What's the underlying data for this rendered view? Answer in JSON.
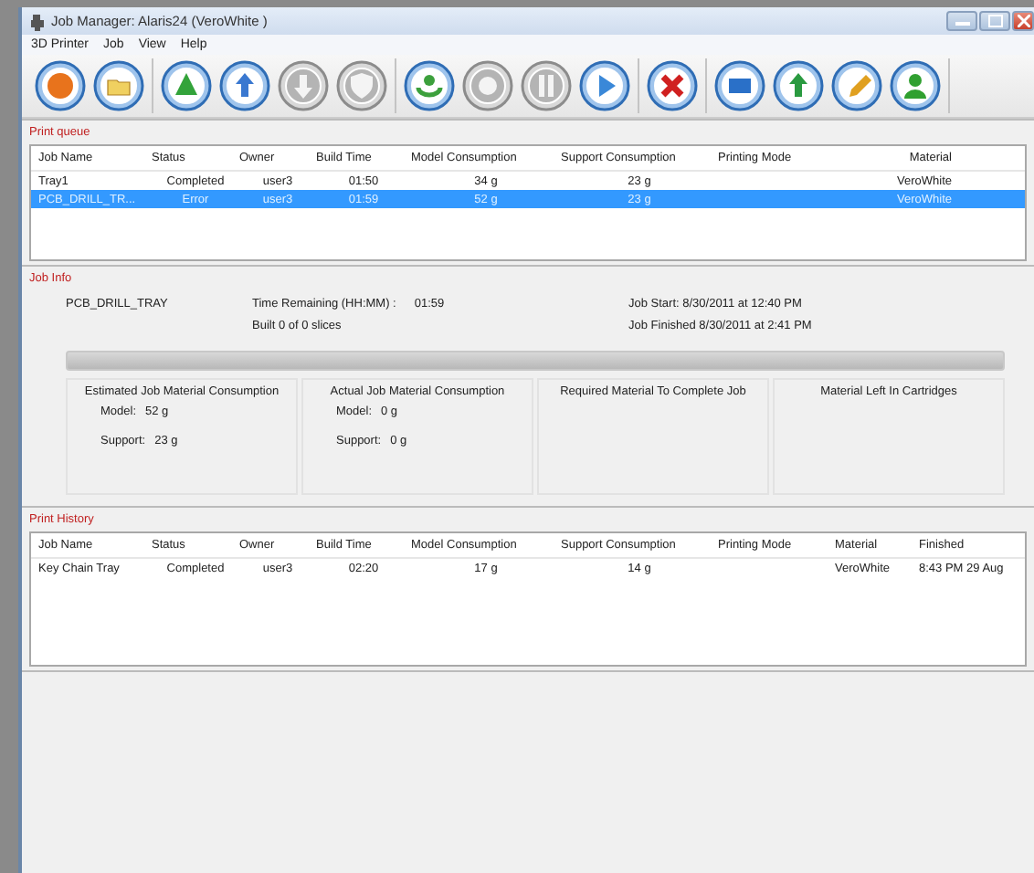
{
  "window": {
    "title": "Job Manager: Alaris24 (VeroWhite )"
  },
  "menu": [
    "3D Printer",
    "Job",
    "View",
    "Help"
  ],
  "toolbar": [
    [
      {
        "disabled": false
      },
      {
        "disabled": false
      }
    ],
    [
      {
        "disabled": false
      },
      {
        "disabled": false
      },
      {
        "disabled": true
      },
      {
        "disabled": true
      }
    ],
    [
      {
        "disabled": false
      },
      {
        "disabled": true
      },
      {
        "disabled": true
      },
      {
        "disabled": false
      }
    ],
    [
      {
        "disabled": false
      }
    ],
    [
      {
        "disabled": false
      },
      {
        "disabled": false
      },
      {
        "disabled": false
      },
      {
        "disabled": false
      }
    ]
  ],
  "print_queue": {
    "title": "Print queue",
    "columns": [
      "Job Name",
      "Status",
      "Owner",
      "Build Time",
      "Model Consumption",
      "Support Consumption",
      "Printing Mode",
      "Material"
    ],
    "rows": [
      {
        "selected": false,
        "cells": [
          "Tray1",
          "Completed",
          "user3",
          "01:50",
          "34 g",
          "23 g",
          "",
          "VeroWhite"
        ]
      },
      {
        "selected": true,
        "cells": [
          "PCB_DRILL_TR...",
          "Error",
          "user3",
          "01:59",
          "52 g",
          "23 g",
          "",
          "VeroWhite"
        ]
      }
    ]
  },
  "job_info": {
    "title": "Job Info",
    "job_name": "PCB_DRILL_TRAY",
    "time_remaining_label": "Time Remaining (HH:MM) :",
    "time_remaining": "01:59",
    "built": "Built 0 of 0 slices",
    "job_start": "Job Start:  8/30/2011 at 12:40 PM",
    "job_finished": "Job Finished 8/30/2011 at 2:41 PM",
    "progress": {
      "level": 0
    },
    "material_boxes": [
      {
        "title": "Estimated Job Material Consumption",
        "entries": [
          {
            "label": "Model:",
            "value": "52 g"
          },
          {
            "label": "Support:",
            "value": "23 g"
          }
        ]
      },
      {
        "title": "Actual Job Material Consumption",
        "entries": [
          {
            "label": "Model:",
            "value": "0 g"
          },
          {
            "label": "Support:",
            "value": "0 g"
          }
        ]
      },
      {
        "title": "Required Material To Complete Job"
      },
      {
        "title": "Material Left In Cartridges"
      }
    ]
  },
  "print_history": {
    "title": "Print History",
    "columns": [
      "Job Name",
      "Status",
      "Owner",
      "Build Time",
      "Model Consumption",
      "Support Consumption",
      "Printing Mode",
      "Material",
      "Finished"
    ],
    "rows": [
      {
        "cells": [
          "Key Chain Tray",
          "Completed",
          "user3",
          "02:20",
          "17 g",
          "14 g",
          "",
          "VeroWhite",
          "8:43 PM 29 Aug"
        ]
      }
    ]
  }
}
